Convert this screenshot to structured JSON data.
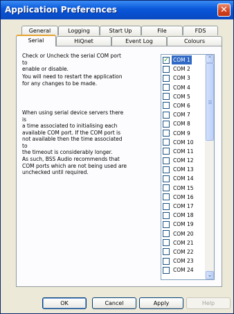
{
  "window": {
    "title": "Application Preferences",
    "close_label": "✕"
  },
  "tabs": {
    "back_row": [
      {
        "label": "General"
      },
      {
        "label": "Logging"
      },
      {
        "label": "Start Up"
      },
      {
        "label": "File"
      },
      {
        "label": "FDS"
      }
    ],
    "front_row": [
      {
        "label": "Serial",
        "active": true
      },
      {
        "label": "HiQnet"
      },
      {
        "label": "Event Log"
      },
      {
        "label": "Colours"
      }
    ]
  },
  "serial": {
    "paragraph_1": "Check or Uncheck the serial COM port to\nenable or disable.",
    "paragraph_2": "You will need to restart the application\nfor any changes to be made.",
    "paragraph_3": "When using serial device servers there is\na time associated to initialising each\navailable COM port. If the COM port is\nnot available then the time associated to\nthe timeout is considerably longer.",
    "paragraph_4": "As such, BSS Audio recommends that\nCOM ports which are not being used are\nunchecked until required.",
    "ports": [
      {
        "label": "COM 1",
        "checked": true,
        "selected": true
      },
      {
        "label": "COM 2",
        "checked": false
      },
      {
        "label": "COM 3",
        "checked": false
      },
      {
        "label": "COM 4",
        "checked": false
      },
      {
        "label": "COM 5",
        "checked": false
      },
      {
        "label": "COM 6",
        "checked": false
      },
      {
        "label": "COM 7",
        "checked": false
      },
      {
        "label": "COM 8",
        "checked": false
      },
      {
        "label": "COM 9",
        "checked": false
      },
      {
        "label": "COM 10",
        "checked": false
      },
      {
        "label": "COM 11",
        "checked": false
      },
      {
        "label": "COM 12",
        "checked": false
      },
      {
        "label": "COM 13",
        "checked": false
      },
      {
        "label": "COM 14",
        "checked": false
      },
      {
        "label": "COM 15",
        "checked": false
      },
      {
        "label": "COM 16",
        "checked": false
      },
      {
        "label": "COM 17",
        "checked": false
      },
      {
        "label": "COM 18",
        "checked": false
      },
      {
        "label": "COM 19",
        "checked": false
      },
      {
        "label": "COM 20",
        "checked": false
      },
      {
        "label": "COM 21",
        "checked": false
      },
      {
        "label": "COM 22",
        "checked": false
      },
      {
        "label": "COM 23",
        "checked": false
      },
      {
        "label": "COM 24",
        "checked": false
      }
    ]
  },
  "buttons": {
    "ok": "OK",
    "cancel": "Cancel",
    "apply": "Apply",
    "help": "Help"
  },
  "colors": {
    "titlebar": "#0a57d9",
    "selection": "#316ac5",
    "active_tab_accent": "#e6a22c",
    "dialog_face": "#ece9d8"
  }
}
